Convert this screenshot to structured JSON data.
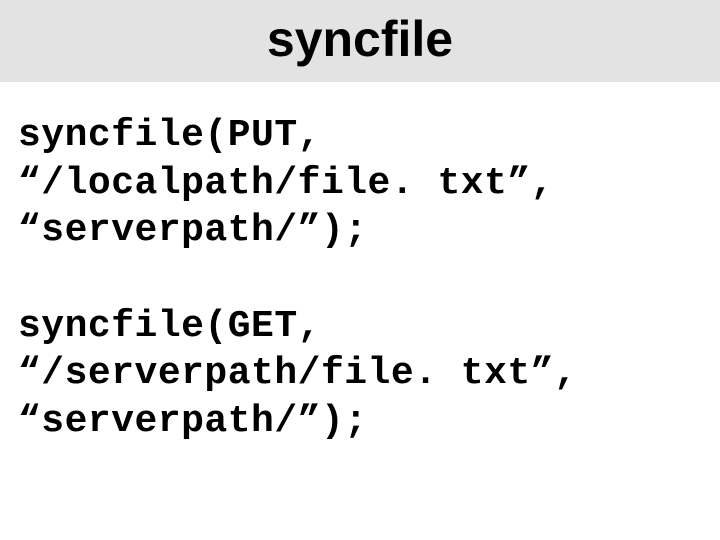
{
  "title": "syncfile",
  "examples": [
    {
      "line1": "syncfile(PUT,",
      "line2": "“/localpath/file. txt”,",
      "line3": "“serverpath/”);"
    },
    {
      "line1": "syncfile(GET,",
      "line2": "“/serverpath/file. txt”,",
      "line3": "“serverpath/”);"
    }
  ]
}
